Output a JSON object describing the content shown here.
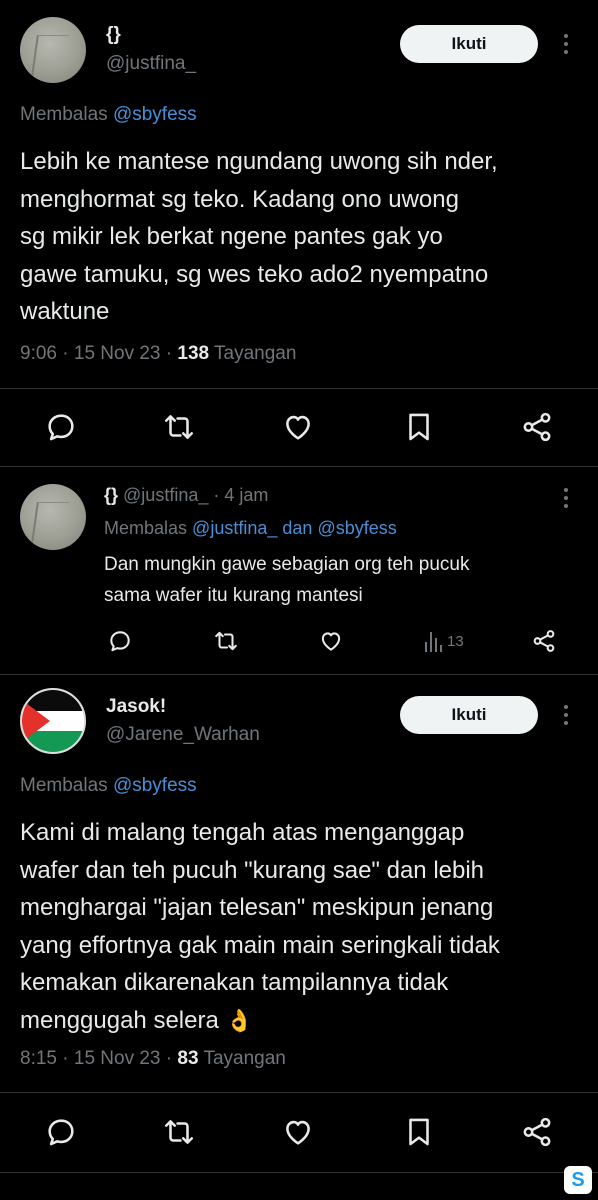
{
  "tweet1": {
    "display_name": "{}",
    "handle": "@justfina_",
    "follow_label": "Ikuti",
    "replying_prefix": "Membalas",
    "replying_to": "@sbyfess",
    "lines": [
      "Lebih ke mantese ngundang uwong sih nder,",
      "menghormat sg teko. Kadang ono uwong",
      "sg mikir lek berkat ngene pantes gak yo",
      "gawe tamuku, sg wes teko ado2 nyempatno",
      "waktune"
    ],
    "time": "9:06",
    "date": "15 Nov 23",
    "views_count": "138",
    "views_label": "Tayangan"
  },
  "reply": {
    "display_name": "{}",
    "handle": "@justfina_",
    "age": "4 jam",
    "replying_prefix": "Membalas",
    "replying_to_1": "@justfina_",
    "replying_and": "dan",
    "replying_to_2": "@sbyfess",
    "lines": [
      "Dan mungkin gawe sebagian org teh pucuk",
      "sama wafer itu kurang mantesi"
    ],
    "views_count": "13"
  },
  "tweet2": {
    "display_name": "Jasok!",
    "handle": "@Jarene_Warhan",
    "follow_label": "Ikuti",
    "replying_prefix": "Membalas",
    "replying_to": "@sbyfess",
    "lines": [
      "Kami di malang tengah atas menganggap",
      "wafer dan teh pucuh \"kurang sae\" dan lebih",
      "menghargai \"jajan telesan\" meskipun jenang",
      "yang effortnya gak main main seringkali tidak",
      "kemakan dikarenakan tampilannya tidak",
      "menggugah selera"
    ],
    "emoji": "👌",
    "time": "8:15",
    "date": "15 Nov 23",
    "views_count": "83",
    "views_label": "Tayangan"
  },
  "separator": "·",
  "colors": {
    "background": "#000000",
    "text": "#e7e9ea",
    "muted": "#71767b",
    "link": "#4a8fd6",
    "button_bg": "#eff3f4"
  },
  "icons": {
    "reply": "reply-icon",
    "retweet": "retweet-icon",
    "like": "heart-icon",
    "bookmark": "bookmark-icon",
    "share": "share-icon",
    "views": "views-icon",
    "more": "more-icon"
  }
}
